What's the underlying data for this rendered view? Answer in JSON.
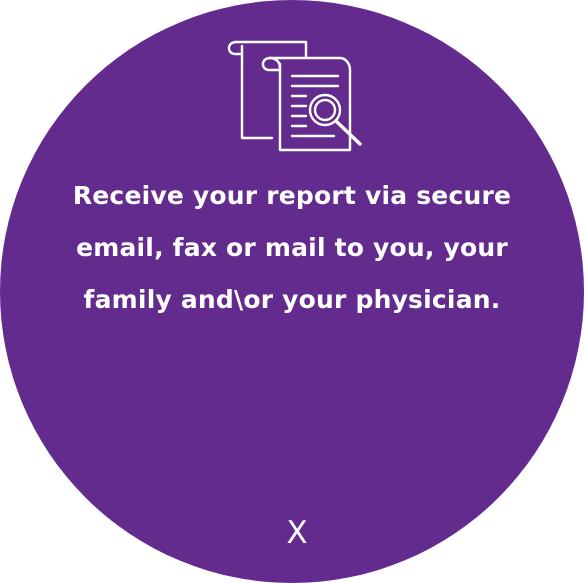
{
  "card": {
    "background_color": "#642b8f",
    "text_color": "#ffffff",
    "icon": "document-magnifier-icon",
    "message_lines": [
      "Receive your report via secure",
      "email, fax or mail to you, your",
      "family and\\or your physician."
    ],
    "close_label": "X"
  }
}
